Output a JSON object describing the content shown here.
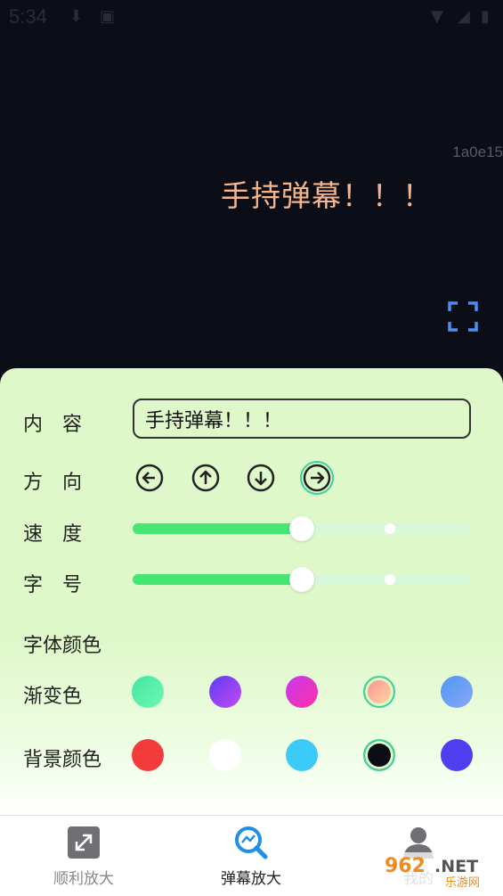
{
  "status_bar": {
    "time": "5:34"
  },
  "stage": {
    "id_label": "1a0e15",
    "danmaku_text": "手持弹幕！！！",
    "danmaku_color": "#f4b58c"
  },
  "panel": {
    "content_label": "内　容",
    "content_value": "手持弹幕！！！",
    "direction_label": "方　向",
    "directions": [
      "left",
      "up",
      "down",
      "right"
    ],
    "selected_direction": "right",
    "speed_label": "速　度",
    "speed_value": 0.5,
    "size_label": "字　号",
    "size_value": 0.5,
    "font_color_label": "字体颜色",
    "gradient_label": "渐变色",
    "gradients": [
      {
        "from": "#43e6a0",
        "to": "#6ef7b5",
        "selected": false
      },
      {
        "from": "#5b3cf5",
        "to": "#c44bf2",
        "selected": false
      },
      {
        "from": "#c63af0",
        "to": "#ff2fa5",
        "selected": false
      },
      {
        "from": "#f98a8a",
        "to": "#ffe0a8",
        "selected": true
      },
      {
        "from": "#4f97f5",
        "to": "#8aa6f9",
        "selected": false
      }
    ],
    "bg_color_label": "背景颜色",
    "bg_colors": [
      {
        "color": "#f33b3b",
        "selected": false
      },
      {
        "color": "#ffffff",
        "selected": false
      },
      {
        "color": "#3ccbf8",
        "selected": false
      },
      {
        "color": "#0b0e17",
        "selected": true
      },
      {
        "color": "#503df0",
        "selected": false
      }
    ]
  },
  "nav": {
    "items": [
      {
        "label": "顺利放大",
        "color": "#888888"
      },
      {
        "label": "弹幕放大",
        "color": "#222222"
      },
      {
        "label": "我的",
        "color": "#888888"
      }
    ]
  },
  "watermark": "962.NET 乐游网"
}
